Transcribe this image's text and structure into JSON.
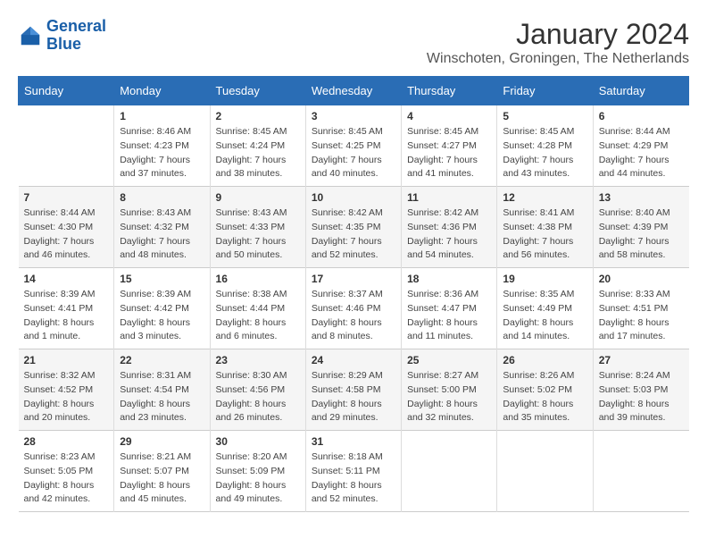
{
  "logo": {
    "line1": "General",
    "line2": "Blue"
  },
  "title": "January 2024",
  "subtitle": "Winschoten, Groningen, The Netherlands",
  "days_of_week": [
    "Sunday",
    "Monday",
    "Tuesday",
    "Wednesday",
    "Thursday",
    "Friday",
    "Saturday"
  ],
  "weeks": [
    [
      {
        "day": "",
        "sunrise": "",
        "sunset": "",
        "daylight": ""
      },
      {
        "day": "1",
        "sunrise": "Sunrise: 8:46 AM",
        "sunset": "Sunset: 4:23 PM",
        "daylight": "Daylight: 7 hours and 37 minutes."
      },
      {
        "day": "2",
        "sunrise": "Sunrise: 8:45 AM",
        "sunset": "Sunset: 4:24 PM",
        "daylight": "Daylight: 7 hours and 38 minutes."
      },
      {
        "day": "3",
        "sunrise": "Sunrise: 8:45 AM",
        "sunset": "Sunset: 4:25 PM",
        "daylight": "Daylight: 7 hours and 40 minutes."
      },
      {
        "day": "4",
        "sunrise": "Sunrise: 8:45 AM",
        "sunset": "Sunset: 4:27 PM",
        "daylight": "Daylight: 7 hours and 41 minutes."
      },
      {
        "day": "5",
        "sunrise": "Sunrise: 8:45 AM",
        "sunset": "Sunset: 4:28 PM",
        "daylight": "Daylight: 7 hours and 43 minutes."
      },
      {
        "day": "6",
        "sunrise": "Sunrise: 8:44 AM",
        "sunset": "Sunset: 4:29 PM",
        "daylight": "Daylight: 7 hours and 44 minutes."
      }
    ],
    [
      {
        "day": "7",
        "sunrise": "Sunrise: 8:44 AM",
        "sunset": "Sunset: 4:30 PM",
        "daylight": "Daylight: 7 hours and 46 minutes."
      },
      {
        "day": "8",
        "sunrise": "Sunrise: 8:43 AM",
        "sunset": "Sunset: 4:32 PM",
        "daylight": "Daylight: 7 hours and 48 minutes."
      },
      {
        "day": "9",
        "sunrise": "Sunrise: 8:43 AM",
        "sunset": "Sunset: 4:33 PM",
        "daylight": "Daylight: 7 hours and 50 minutes."
      },
      {
        "day": "10",
        "sunrise": "Sunrise: 8:42 AM",
        "sunset": "Sunset: 4:35 PM",
        "daylight": "Daylight: 7 hours and 52 minutes."
      },
      {
        "day": "11",
        "sunrise": "Sunrise: 8:42 AM",
        "sunset": "Sunset: 4:36 PM",
        "daylight": "Daylight: 7 hours and 54 minutes."
      },
      {
        "day": "12",
        "sunrise": "Sunrise: 8:41 AM",
        "sunset": "Sunset: 4:38 PM",
        "daylight": "Daylight: 7 hours and 56 minutes."
      },
      {
        "day": "13",
        "sunrise": "Sunrise: 8:40 AM",
        "sunset": "Sunset: 4:39 PM",
        "daylight": "Daylight: 7 hours and 58 minutes."
      }
    ],
    [
      {
        "day": "14",
        "sunrise": "Sunrise: 8:39 AM",
        "sunset": "Sunset: 4:41 PM",
        "daylight": "Daylight: 8 hours and 1 minute."
      },
      {
        "day": "15",
        "sunrise": "Sunrise: 8:39 AM",
        "sunset": "Sunset: 4:42 PM",
        "daylight": "Daylight: 8 hours and 3 minutes."
      },
      {
        "day": "16",
        "sunrise": "Sunrise: 8:38 AM",
        "sunset": "Sunset: 4:44 PM",
        "daylight": "Daylight: 8 hours and 6 minutes."
      },
      {
        "day": "17",
        "sunrise": "Sunrise: 8:37 AM",
        "sunset": "Sunset: 4:46 PM",
        "daylight": "Daylight: 8 hours and 8 minutes."
      },
      {
        "day": "18",
        "sunrise": "Sunrise: 8:36 AM",
        "sunset": "Sunset: 4:47 PM",
        "daylight": "Daylight: 8 hours and 11 minutes."
      },
      {
        "day": "19",
        "sunrise": "Sunrise: 8:35 AM",
        "sunset": "Sunset: 4:49 PM",
        "daylight": "Daylight: 8 hours and 14 minutes."
      },
      {
        "day": "20",
        "sunrise": "Sunrise: 8:33 AM",
        "sunset": "Sunset: 4:51 PM",
        "daylight": "Daylight: 8 hours and 17 minutes."
      }
    ],
    [
      {
        "day": "21",
        "sunrise": "Sunrise: 8:32 AM",
        "sunset": "Sunset: 4:52 PM",
        "daylight": "Daylight: 8 hours and 20 minutes."
      },
      {
        "day": "22",
        "sunrise": "Sunrise: 8:31 AM",
        "sunset": "Sunset: 4:54 PM",
        "daylight": "Daylight: 8 hours and 23 minutes."
      },
      {
        "day": "23",
        "sunrise": "Sunrise: 8:30 AM",
        "sunset": "Sunset: 4:56 PM",
        "daylight": "Daylight: 8 hours and 26 minutes."
      },
      {
        "day": "24",
        "sunrise": "Sunrise: 8:29 AM",
        "sunset": "Sunset: 4:58 PM",
        "daylight": "Daylight: 8 hours and 29 minutes."
      },
      {
        "day": "25",
        "sunrise": "Sunrise: 8:27 AM",
        "sunset": "Sunset: 5:00 PM",
        "daylight": "Daylight: 8 hours and 32 minutes."
      },
      {
        "day": "26",
        "sunrise": "Sunrise: 8:26 AM",
        "sunset": "Sunset: 5:02 PM",
        "daylight": "Daylight: 8 hours and 35 minutes."
      },
      {
        "day": "27",
        "sunrise": "Sunrise: 8:24 AM",
        "sunset": "Sunset: 5:03 PM",
        "daylight": "Daylight: 8 hours and 39 minutes."
      }
    ],
    [
      {
        "day": "28",
        "sunrise": "Sunrise: 8:23 AM",
        "sunset": "Sunset: 5:05 PM",
        "daylight": "Daylight: 8 hours and 42 minutes."
      },
      {
        "day": "29",
        "sunrise": "Sunrise: 8:21 AM",
        "sunset": "Sunset: 5:07 PM",
        "daylight": "Daylight: 8 hours and 45 minutes."
      },
      {
        "day": "30",
        "sunrise": "Sunrise: 8:20 AM",
        "sunset": "Sunset: 5:09 PM",
        "daylight": "Daylight: 8 hours and 49 minutes."
      },
      {
        "day": "31",
        "sunrise": "Sunrise: 8:18 AM",
        "sunset": "Sunset: 5:11 PM",
        "daylight": "Daylight: 8 hours and 52 minutes."
      },
      {
        "day": "",
        "sunrise": "",
        "sunset": "",
        "daylight": ""
      },
      {
        "day": "",
        "sunrise": "",
        "sunset": "",
        "daylight": ""
      },
      {
        "day": "",
        "sunrise": "",
        "sunset": "",
        "daylight": ""
      }
    ]
  ]
}
